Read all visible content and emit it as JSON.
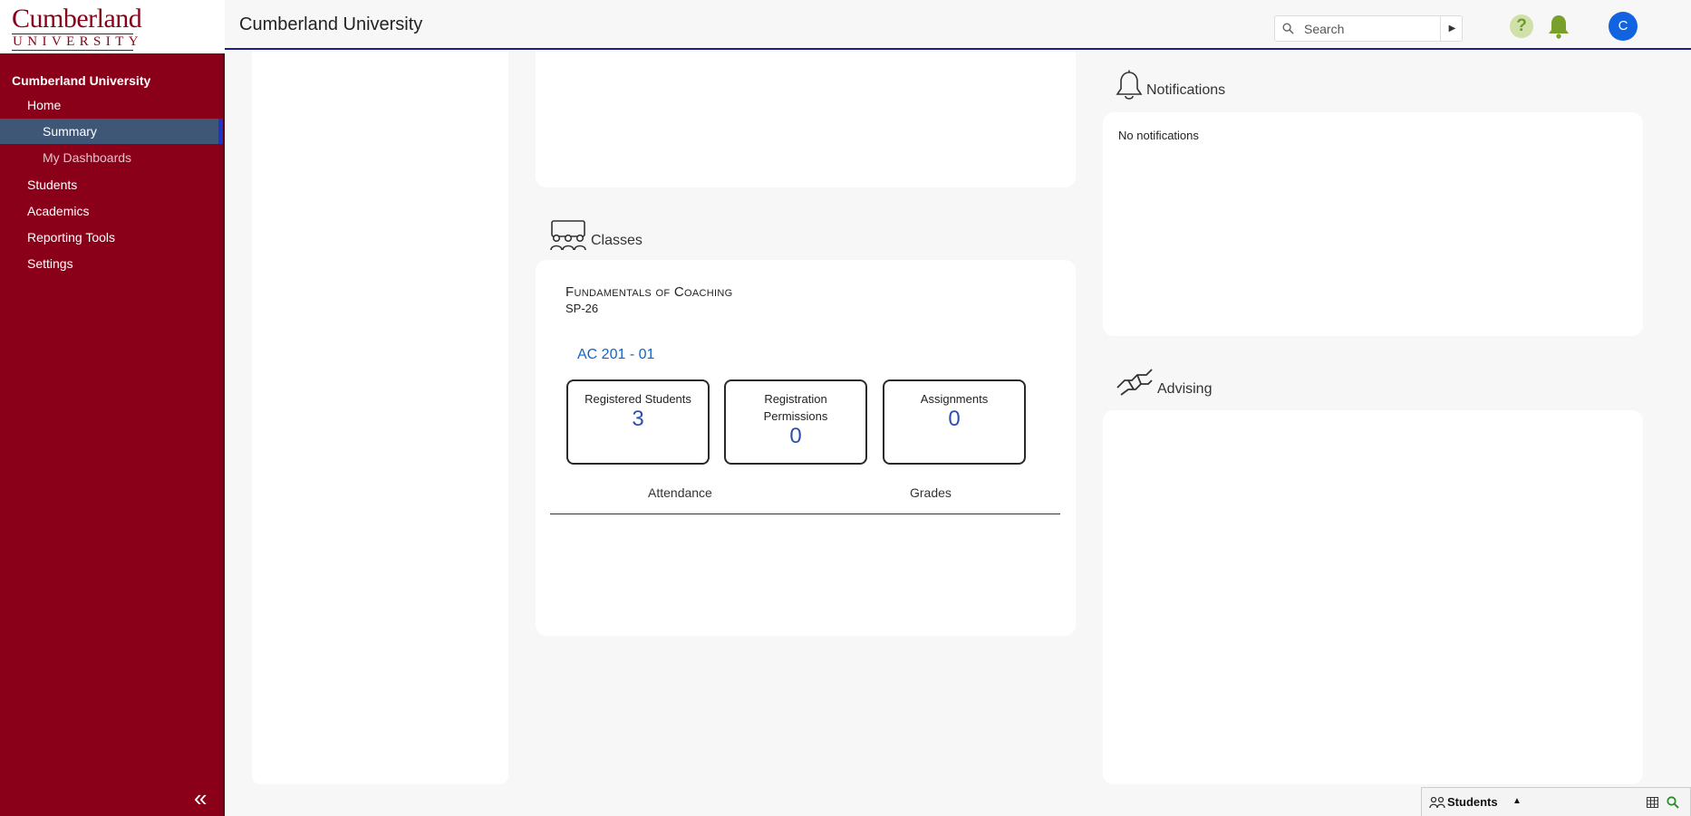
{
  "sidebar": {
    "logo_main": "Cumberland",
    "logo_sub": "UNIVERSITY",
    "org_title": "Cumberland University",
    "items": [
      {
        "label": "Home"
      },
      {
        "label": "Summary"
      },
      {
        "label": "My Dashboards"
      },
      {
        "label": "Students"
      },
      {
        "label": "Academics"
      },
      {
        "label": "Reporting Tools"
      },
      {
        "label": "Settings"
      }
    ],
    "collapse_glyph": "«"
  },
  "header": {
    "title": "Cumberland University",
    "search_placeholder": "Search",
    "search_go_glyph": "▶",
    "help_glyph": "?",
    "avatar_initial": "C"
  },
  "classes": {
    "heading": "Classes",
    "course_title": "Fundamentals of Coaching",
    "term": "SP-26",
    "section": "AC 201 - 01",
    "stats": [
      {
        "label": "Registered Students",
        "value": "3"
      },
      {
        "label": "Registration Permissions",
        "value": "0"
      },
      {
        "label": "Assignments",
        "value": "0"
      }
    ],
    "tabs": [
      {
        "label": "Attendance"
      },
      {
        "label": "Grades"
      }
    ]
  },
  "notifications": {
    "heading": "Notifications",
    "empty_text": "No notifications"
  },
  "advising": {
    "heading": "Advising"
  },
  "drawer": {
    "label": "Students",
    "arrow_glyph": "▲"
  },
  "colors": {
    "brand": "#8b0019",
    "active_nav": "#3f5776",
    "link": "#1263c9",
    "stat_value": "#2b4fb5",
    "avatar": "#1263e0",
    "bell": "#7aa02c"
  }
}
